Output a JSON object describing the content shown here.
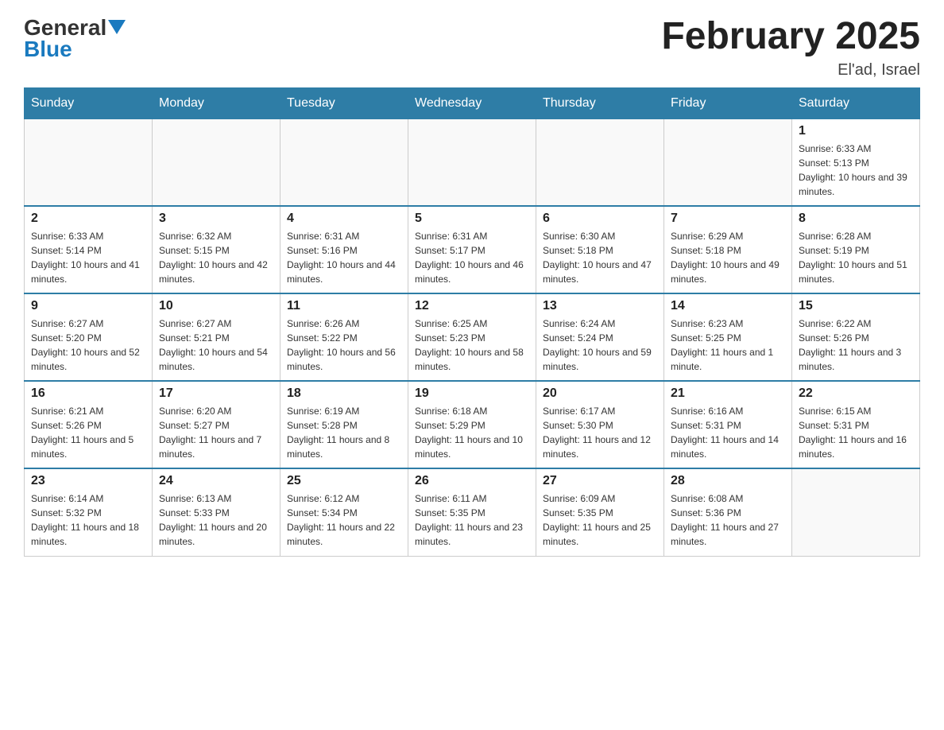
{
  "header": {
    "logo_general": "General",
    "logo_blue": "Blue",
    "month_title": "February 2025",
    "location": "El'ad, Israel"
  },
  "days_of_week": [
    "Sunday",
    "Monday",
    "Tuesday",
    "Wednesday",
    "Thursday",
    "Friday",
    "Saturday"
  ],
  "weeks": [
    {
      "days": [
        {
          "num": "",
          "info": ""
        },
        {
          "num": "",
          "info": ""
        },
        {
          "num": "",
          "info": ""
        },
        {
          "num": "",
          "info": ""
        },
        {
          "num": "",
          "info": ""
        },
        {
          "num": "",
          "info": ""
        },
        {
          "num": "1",
          "info": "Sunrise: 6:33 AM\nSunset: 5:13 PM\nDaylight: 10 hours and 39 minutes."
        }
      ]
    },
    {
      "days": [
        {
          "num": "2",
          "info": "Sunrise: 6:33 AM\nSunset: 5:14 PM\nDaylight: 10 hours and 41 minutes."
        },
        {
          "num": "3",
          "info": "Sunrise: 6:32 AM\nSunset: 5:15 PM\nDaylight: 10 hours and 42 minutes."
        },
        {
          "num": "4",
          "info": "Sunrise: 6:31 AM\nSunset: 5:16 PM\nDaylight: 10 hours and 44 minutes."
        },
        {
          "num": "5",
          "info": "Sunrise: 6:31 AM\nSunset: 5:17 PM\nDaylight: 10 hours and 46 minutes."
        },
        {
          "num": "6",
          "info": "Sunrise: 6:30 AM\nSunset: 5:18 PM\nDaylight: 10 hours and 47 minutes."
        },
        {
          "num": "7",
          "info": "Sunrise: 6:29 AM\nSunset: 5:18 PM\nDaylight: 10 hours and 49 minutes."
        },
        {
          "num": "8",
          "info": "Sunrise: 6:28 AM\nSunset: 5:19 PM\nDaylight: 10 hours and 51 minutes."
        }
      ]
    },
    {
      "days": [
        {
          "num": "9",
          "info": "Sunrise: 6:27 AM\nSunset: 5:20 PM\nDaylight: 10 hours and 52 minutes."
        },
        {
          "num": "10",
          "info": "Sunrise: 6:27 AM\nSunset: 5:21 PM\nDaylight: 10 hours and 54 minutes."
        },
        {
          "num": "11",
          "info": "Sunrise: 6:26 AM\nSunset: 5:22 PM\nDaylight: 10 hours and 56 minutes."
        },
        {
          "num": "12",
          "info": "Sunrise: 6:25 AM\nSunset: 5:23 PM\nDaylight: 10 hours and 58 minutes."
        },
        {
          "num": "13",
          "info": "Sunrise: 6:24 AM\nSunset: 5:24 PM\nDaylight: 10 hours and 59 minutes."
        },
        {
          "num": "14",
          "info": "Sunrise: 6:23 AM\nSunset: 5:25 PM\nDaylight: 11 hours and 1 minute."
        },
        {
          "num": "15",
          "info": "Sunrise: 6:22 AM\nSunset: 5:26 PM\nDaylight: 11 hours and 3 minutes."
        }
      ]
    },
    {
      "days": [
        {
          "num": "16",
          "info": "Sunrise: 6:21 AM\nSunset: 5:26 PM\nDaylight: 11 hours and 5 minutes."
        },
        {
          "num": "17",
          "info": "Sunrise: 6:20 AM\nSunset: 5:27 PM\nDaylight: 11 hours and 7 minutes."
        },
        {
          "num": "18",
          "info": "Sunrise: 6:19 AM\nSunset: 5:28 PM\nDaylight: 11 hours and 8 minutes."
        },
        {
          "num": "19",
          "info": "Sunrise: 6:18 AM\nSunset: 5:29 PM\nDaylight: 11 hours and 10 minutes."
        },
        {
          "num": "20",
          "info": "Sunrise: 6:17 AM\nSunset: 5:30 PM\nDaylight: 11 hours and 12 minutes."
        },
        {
          "num": "21",
          "info": "Sunrise: 6:16 AM\nSunset: 5:31 PM\nDaylight: 11 hours and 14 minutes."
        },
        {
          "num": "22",
          "info": "Sunrise: 6:15 AM\nSunset: 5:31 PM\nDaylight: 11 hours and 16 minutes."
        }
      ]
    },
    {
      "days": [
        {
          "num": "23",
          "info": "Sunrise: 6:14 AM\nSunset: 5:32 PM\nDaylight: 11 hours and 18 minutes."
        },
        {
          "num": "24",
          "info": "Sunrise: 6:13 AM\nSunset: 5:33 PM\nDaylight: 11 hours and 20 minutes."
        },
        {
          "num": "25",
          "info": "Sunrise: 6:12 AM\nSunset: 5:34 PM\nDaylight: 11 hours and 22 minutes."
        },
        {
          "num": "26",
          "info": "Sunrise: 6:11 AM\nSunset: 5:35 PM\nDaylight: 11 hours and 23 minutes."
        },
        {
          "num": "27",
          "info": "Sunrise: 6:09 AM\nSunset: 5:35 PM\nDaylight: 11 hours and 25 minutes."
        },
        {
          "num": "28",
          "info": "Sunrise: 6:08 AM\nSunset: 5:36 PM\nDaylight: 11 hours and 27 minutes."
        },
        {
          "num": "",
          "info": ""
        }
      ]
    }
  ]
}
